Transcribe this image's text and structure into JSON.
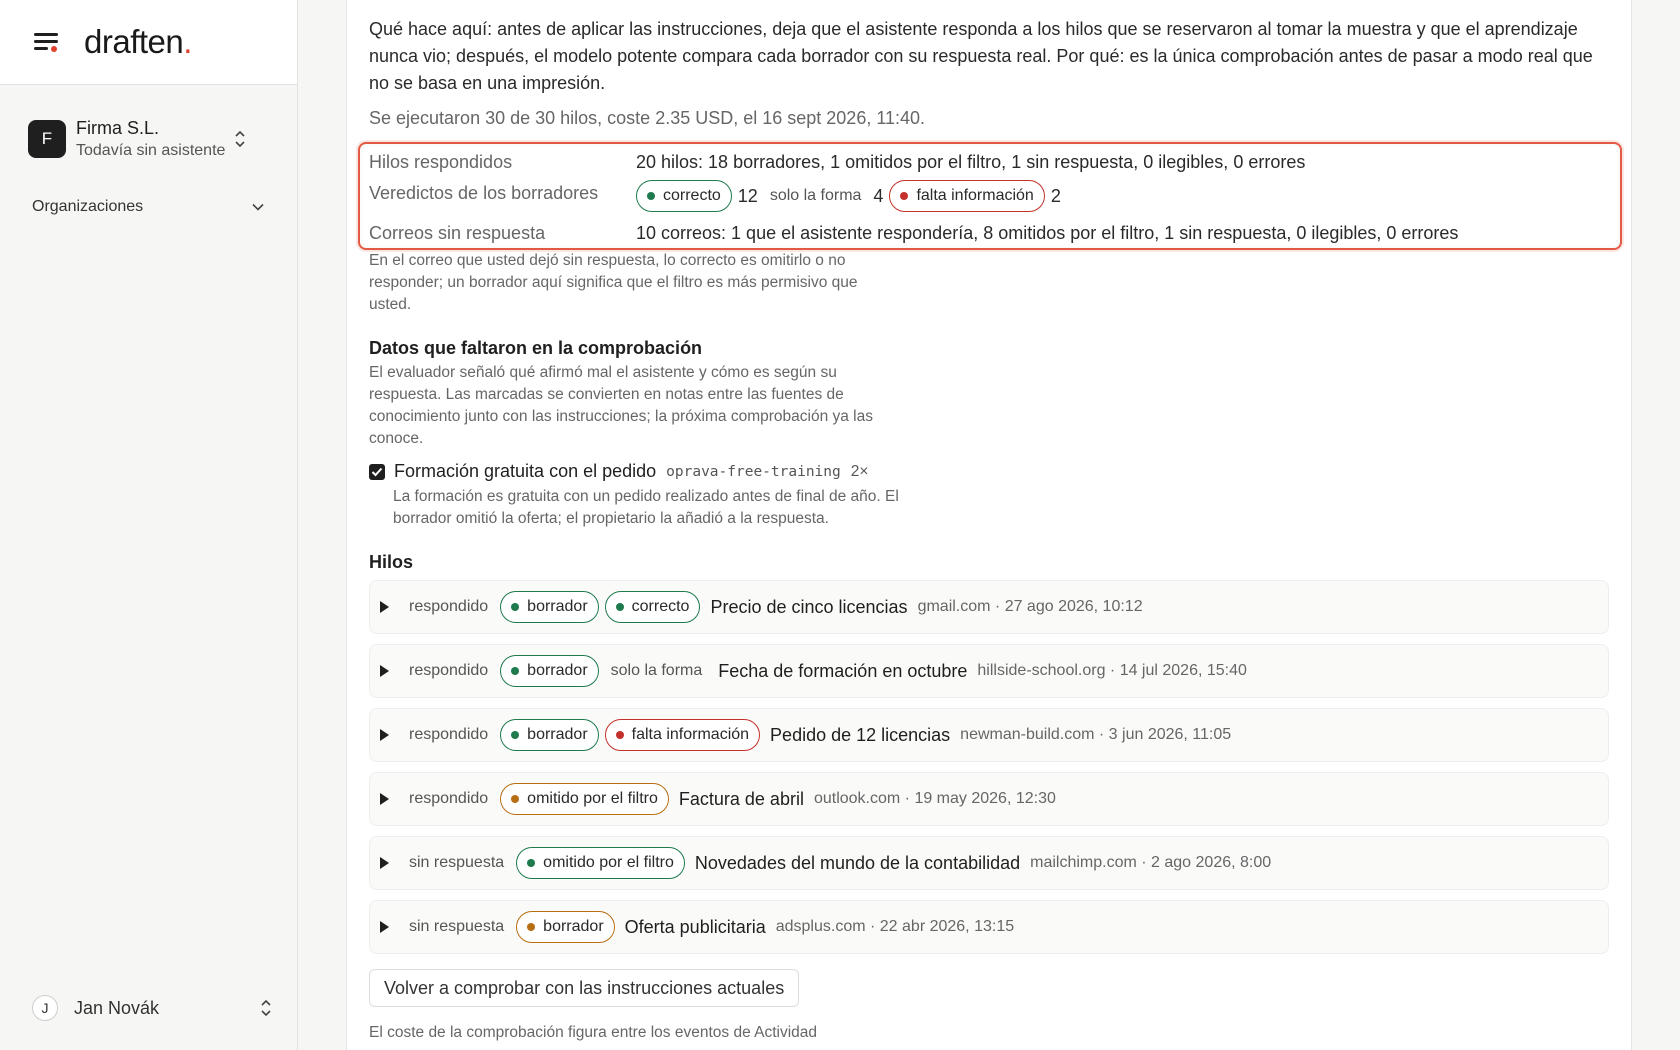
{
  "app": {
    "logo": "draften",
    "logo_dot": "."
  },
  "sidebar": {
    "org_initial": "F",
    "org_name": "Firma S.L.",
    "org_sub": "Todavía sin asistente",
    "nav_label": "Organizaciones",
    "user_initial": "J",
    "user_name": "Jan Novák"
  },
  "intro": {
    "text": "Qué hace aquí: antes de aplicar las instrucciones, deja que el asistente responda a los hilos que se reservaron al tomar la muestra y que el aprendizaje nunca vio; después, el modelo potente compara cada borrador con su respuesta real. Por qué: es la única comprobación antes de pasar a modo real que no se basa en una impresión.",
    "run_line": "Se ejecutaron 30 de 30 hilos, coste 2.35 USD, el 16 sept 2026, 11:40."
  },
  "summary": {
    "answered_label": "Hilos respondidos",
    "answered_value": "20 hilos: 18 borradores, 1 omitidos por el filtro, 1 sin respuesta, 0 ilegibles, 0 errores",
    "verdicts_label": "Veredictos de los borradores",
    "verdict_correct": "correcto",
    "verdict_correct_count": "12",
    "verdict_form": "solo la forma",
    "verdict_form_count": "4",
    "verdict_missing": "falta información",
    "verdict_missing_count": "2",
    "unanswered_label": "Correos sin respuesta",
    "unanswered_value": "10 correos: 1 que el asistente respondería, 8 omitidos por el filtro, 1 sin respuesta, 0 ilegibles, 0 errores"
  },
  "note": "En el correo que usted dejó sin respuesta, lo correcto es omitirlo o no responder; un borrador aquí significa que el filtro es más permisivo que usted.",
  "missing_data": {
    "heading": "Datos que faltaron en la comprobación",
    "description": "El evaluador señaló qué afirmó mal el asistente y cómo es según su respuesta. Las marcadas se convierten en notas entre las fuentes de conocimiento junto con las instrucciones; la próxima comprobación ya las conoce.",
    "item_title": "Formación gratuita con el pedido",
    "item_code": "oprava-free-training",
    "item_count": "2×",
    "item_desc": "La formación es gratuita con un pedido realizado antes de final de año. El borrador omitió la oferta; el propietario la añadió a la respuesta.",
    "item_checked": true
  },
  "threads": {
    "heading": "Hilos",
    "rows": [
      {
        "state": "respondido",
        "tag1": "borrador",
        "tag1_color": "green",
        "tag2": "correcto",
        "tag2_color": "green",
        "subject": "Precio de cinco licencias",
        "meta": "gmail.com · 27 ago 2026, 10:12"
      },
      {
        "state": "respondido",
        "tag1": "borrador",
        "tag1_color": "green",
        "tag2": "solo la forma",
        "tag2_color": "plain",
        "subject": "Fecha de formación en octubre",
        "meta": "hillside-school.org · 14 jul 2026, 15:40"
      },
      {
        "state": "respondido",
        "tag1": "borrador",
        "tag1_color": "green",
        "tag2": "falta información",
        "tag2_color": "red",
        "subject": "Pedido de 12 licencias",
        "meta": "newman-build.com · 3 jun 2026, 11:05"
      },
      {
        "state": "respondido",
        "tag1": "omitido por el filtro",
        "tag1_color": "orange",
        "subject": "Factura de abril",
        "meta": "outlook.com · 19 may 2026, 12:30"
      },
      {
        "state": "sin respuesta",
        "tag1": "omitido por el filtro",
        "tag1_color": "green",
        "subject": "Novedades del mundo de la contabilidad",
        "meta": "mailchimp.com · 2 ago 2026, 8:00"
      },
      {
        "state": "sin respuesta",
        "tag1": "borrador",
        "tag1_color": "orange",
        "subject": "Oferta publicitaria",
        "meta": "adsplus.com · 22 abr 2026, 13:15"
      }
    ]
  },
  "actions": {
    "recheck_label": "Volver a comprobar con las instrucciones actuales",
    "footnote": "El coste de la comprobación figura entre los eventos de Actividad"
  }
}
